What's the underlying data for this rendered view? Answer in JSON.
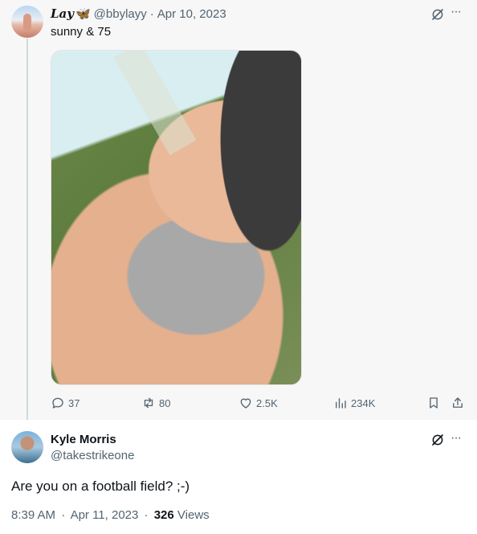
{
  "tweet": {
    "display_name": "Lay",
    "name_emoji": "🦋",
    "handle": "@bbylayy",
    "separator": "·",
    "date": "Apr 10, 2023",
    "text": "sunny & 75",
    "more": "···",
    "stats": {
      "replies": "37",
      "reposts": "80",
      "likes": "2.5K",
      "views": "234K"
    }
  },
  "reply": {
    "display_name": "Kyle Morris",
    "handle": "@takestrikeone",
    "text": "Are you on a football field?  ;-)",
    "more": "···",
    "time": "8:39 AM",
    "separator1": "·",
    "date": "Apr 11, 2023",
    "separator2": "·",
    "views_count": "326",
    "views_label": "Views"
  },
  "colors": {
    "muted": "#536471",
    "text": "#0f1419",
    "parent_bg": "#f7f7f7",
    "butterfly": "#3b7fe0"
  },
  "icons": [
    "grok-icon",
    "more-icon",
    "reply-icon",
    "repost-icon",
    "like-icon",
    "views-icon",
    "bookmark-icon",
    "share-icon",
    "butterfly-emoji"
  ]
}
